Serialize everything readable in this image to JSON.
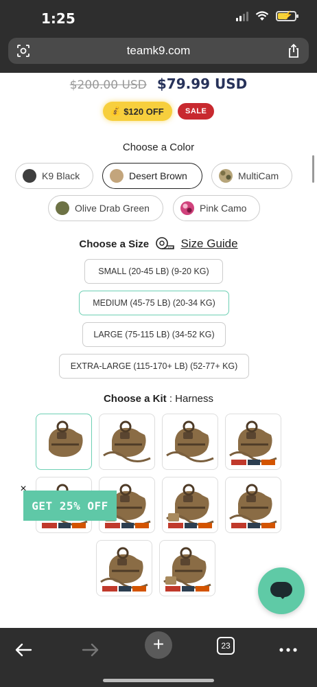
{
  "status_bar": {
    "time": "1:25"
  },
  "browser": {
    "url": "teamk9.com",
    "tabs_count": "23"
  },
  "pricing": {
    "original_price": "$200.00 USD",
    "sale_price": "$79.99 USD",
    "discount_badge": "$120 OFF",
    "sale_badge": "SALE"
  },
  "color_section": {
    "label": "Choose a Color",
    "selected": "Desert Brown",
    "options": [
      {
        "label": "K9 Black",
        "swatch": "#3e3e3e"
      },
      {
        "label": "Desert Brown",
        "swatch": "#c3a57c"
      },
      {
        "label": "MultiCam",
        "swatch": "#a39463"
      },
      {
        "label": "Olive Drab Green",
        "swatch": "#6d7245"
      },
      {
        "label": "Pink Camo",
        "swatch": "#d0427c"
      }
    ]
  },
  "size_section": {
    "label": "Choose a Size",
    "guide_link": "Size Guide",
    "selected": "MEDIUM (45-75 LB) (20-34 KG)",
    "options": [
      "SMALL (20-45 LB) (9-20 KG)",
      "MEDIUM (45-75 LB) (20-34 KG)",
      "LARGE (75-115 LB) (34-52 KG)",
      "EXTRA-LARGE (115-170+ LB) (52-77+ KG)"
    ]
  },
  "kit_section": {
    "label": "Choose a Kit",
    "separator": ":",
    "selected": "Harness",
    "thumbnails": [
      "kit-1",
      "kit-2",
      "kit-3",
      "kit-4",
      "kit-5",
      "kit-6",
      "kit-7",
      "kit-8",
      "kit-9",
      "kit-10"
    ]
  },
  "promo": {
    "label": "GET 25% OFF",
    "close": "×"
  },
  "colors": {
    "accent": "#5fc8a7",
    "price": "#27325a",
    "sale": "#c8292f",
    "badge": "#f7cf3d"
  }
}
